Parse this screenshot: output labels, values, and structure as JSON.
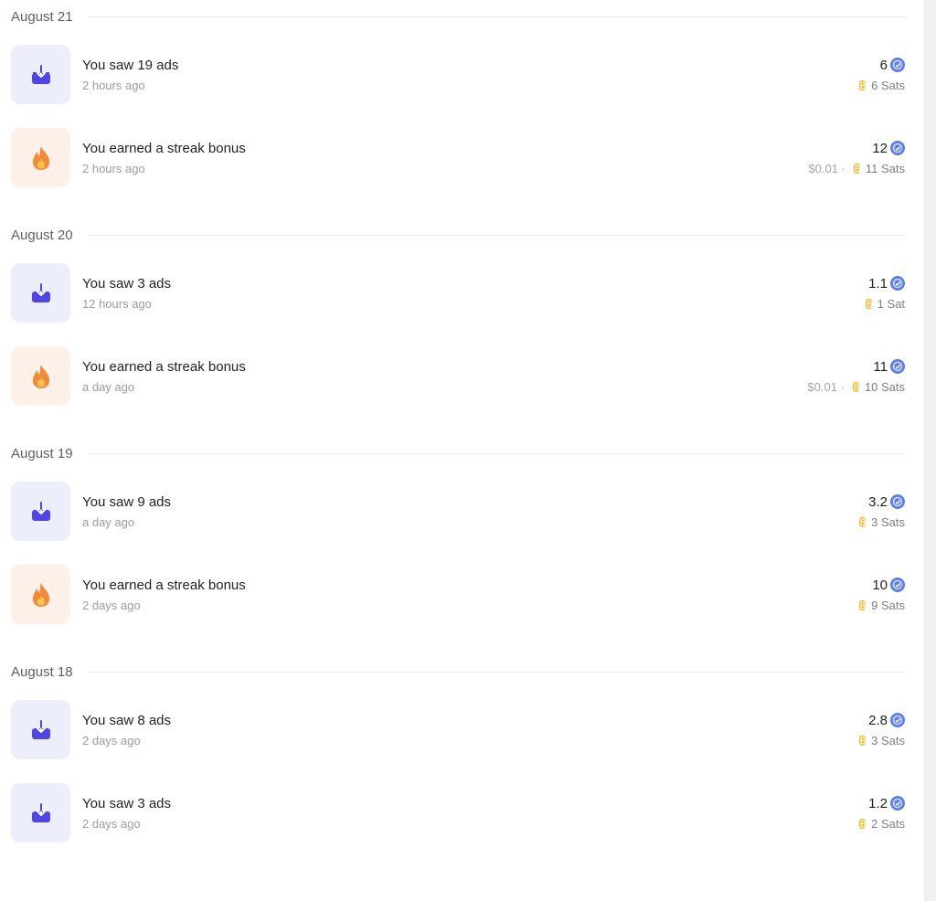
{
  "colors": {
    "ads_icon_bg": "#eceefb",
    "ads_icon_fg": "#4f46e5",
    "streak_icon_bg": "#fdf0e8",
    "streak_icon_fg": "#f08a3c",
    "token_blue": "#5b7ee5",
    "btc_gold": "#f4b728"
  },
  "groups": [
    {
      "date": "August 21",
      "items": [
        {
          "type": "ads",
          "icon": "download-icon",
          "title": "You saw 19 ads",
          "time": "2 hours ago",
          "amount": "6",
          "usd": "",
          "sats": "6 Sats"
        },
        {
          "type": "streak",
          "icon": "fire-icon",
          "title": "You earned a streak bonus",
          "time": "2 hours ago",
          "amount": "12",
          "usd": "$0.01 ·",
          "sats": "11 Sats"
        }
      ]
    },
    {
      "date": "August 20",
      "items": [
        {
          "type": "ads",
          "icon": "download-icon",
          "title": "You saw 3 ads",
          "time": "12 hours ago",
          "amount": "1.1",
          "usd": "",
          "sats": "1 Sat"
        },
        {
          "type": "streak",
          "icon": "fire-icon",
          "title": "You earned a streak bonus",
          "time": "a day ago",
          "amount": "11",
          "usd": "$0.01 ·",
          "sats": "10 Sats"
        }
      ]
    },
    {
      "date": "August 19",
      "items": [
        {
          "type": "ads",
          "icon": "download-icon",
          "title": "You saw 9 ads",
          "time": "a day ago",
          "amount": "3.2",
          "usd": "",
          "sats": "3 Sats"
        },
        {
          "type": "streak",
          "icon": "fire-icon",
          "title": "You earned a streak bonus",
          "time": "2 days ago",
          "amount": "10",
          "usd": "",
          "sats": "9 Sats"
        }
      ]
    },
    {
      "date": "August 18",
      "items": [
        {
          "type": "ads",
          "icon": "download-icon",
          "title": "You saw 8 ads",
          "time": "2 days ago",
          "amount": "2.8",
          "usd": "",
          "sats": "3 Sats"
        },
        {
          "type": "ads",
          "icon": "download-icon",
          "title": "You saw 3 ads",
          "time": "2 days ago",
          "amount": "1.2",
          "usd": "",
          "sats": "2 Sats"
        }
      ]
    }
  ]
}
